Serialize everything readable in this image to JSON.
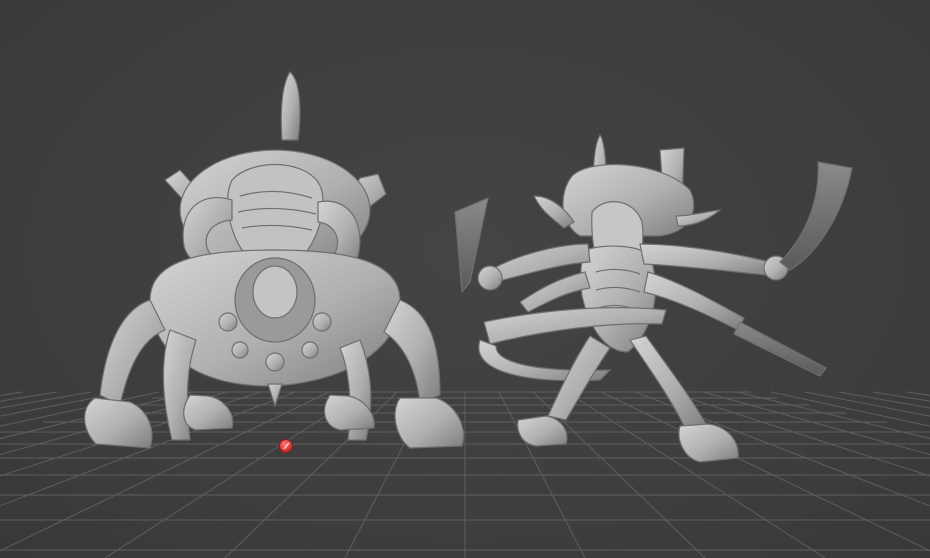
{
  "viewport": {
    "background_color": "#3f3f3f",
    "grid_color": "#6a6a6a",
    "model_color": "#b5b5b5",
    "origin_marker_color": "#e0393e"
  },
  "models": [
    {
      "name": "hulking-beast-miniature",
      "icon": "creature-model-icon"
    },
    {
      "name": "multi-armed-warrior-miniature",
      "icon": "creature-model-icon"
    }
  ],
  "origin_marker": {
    "icon": "origin-point-icon"
  }
}
